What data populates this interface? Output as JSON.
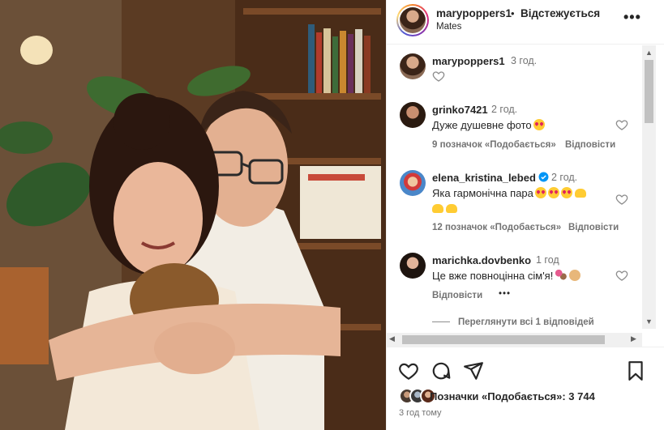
{
  "header": {
    "username": "marypoppers1",
    "separator": "•",
    "follow_status": "Відстежується",
    "location": "Mates"
  },
  "caption": {
    "username": "marypoppers1",
    "time": "3 год."
  },
  "comments": [
    {
      "username": "grinko7421",
      "time": "2 год.",
      "text": "Дуже душевне фото",
      "likes": "9 позначок «Подобається»",
      "reply": "Відповісти"
    },
    {
      "username": "elena_kristina_lebed",
      "verified": true,
      "time": "2 год.",
      "text": "Яка гармонічна пара",
      "likes": "12 позначок «Подобається»",
      "reply": "Відповісти"
    },
    {
      "username": "marichka.dovbenko",
      "time": "1 год",
      "text": "Це вже повноцінна сім'я!",
      "reply": "Відповісти",
      "more": "•••"
    }
  ],
  "view_replies": "Переглянути всі 1 відповідей",
  "footer": {
    "likes": "Позначки «Подобається»: 3 744",
    "post_time": "3 год тому"
  },
  "icons": [
    "more-icon",
    "heart-icon",
    "comment-icon",
    "share-icon",
    "bookmark-icon",
    "verified-icon"
  ],
  "colors": {
    "accent": "#0095f6",
    "text": "#262626",
    "muted": "#737373",
    "border": "#efefef"
  }
}
